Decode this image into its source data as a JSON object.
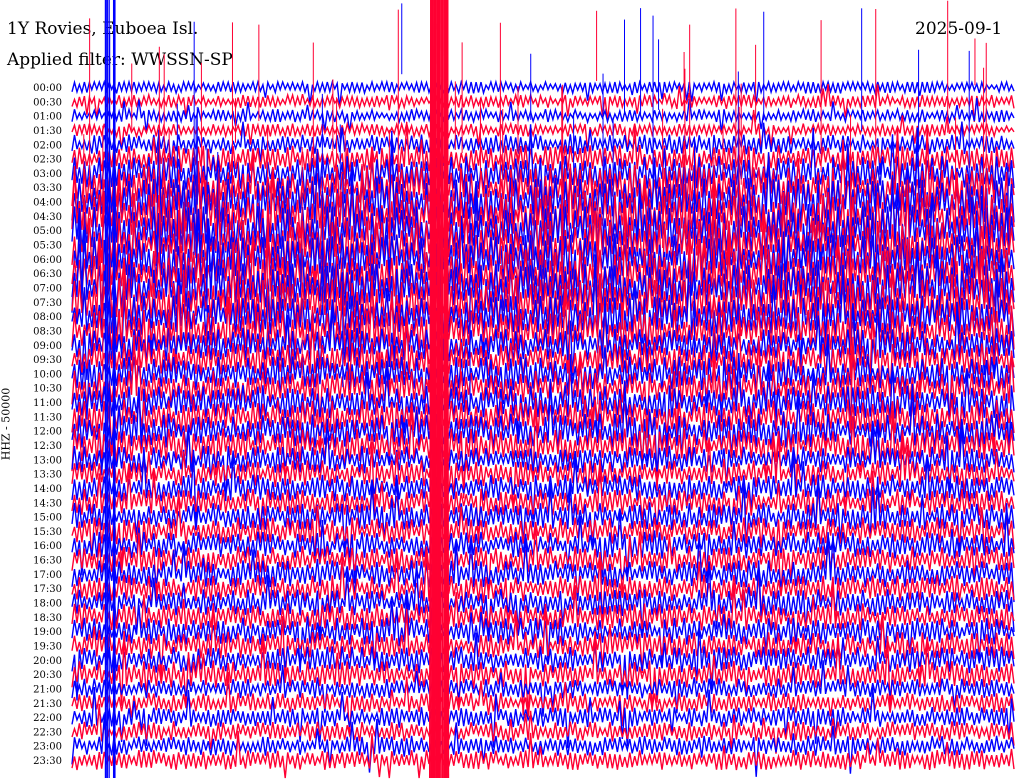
{
  "header": {
    "station": "1Y Rovies, Euboea Isl.",
    "filter": "Applied filter: WWSSN-SP",
    "date": "2025-09-1"
  },
  "chart_data": {
    "type": "line",
    "ylabel": "HHZ - 50000",
    "row_labels": [
      "00:00",
      "00:30",
      "01:00",
      "01:30",
      "02:00",
      "02:30",
      "03:00",
      "03:30",
      "04:00",
      "04:30",
      "05:00",
      "05:30",
      "06:00",
      "06:30",
      "07:00",
      "07:30",
      "08:00",
      "08:30",
      "09:00",
      "09:30",
      "10:00",
      "10:30",
      "11:00",
      "11:30",
      "12:00",
      "12:30",
      "13:00",
      "13:30",
      "14:00",
      "14:30",
      "15:00",
      "15:30",
      "16:00",
      "16:30",
      "17:00",
      "17:30",
      "18:00",
      "18:30",
      "19:00",
      "19:30",
      "20:00",
      "20:30",
      "21:00",
      "21:30",
      "22:00",
      "22:30",
      "23:00",
      "23:30"
    ],
    "series_colors": [
      "#0000ff",
      "#ff0033"
    ],
    "noise_level": [
      1,
      1,
      1,
      1,
      2,
      3,
      4,
      5,
      6,
      6,
      6,
      6,
      6,
      6,
      6,
      6,
      5,
      5,
      4,
      4,
      4,
      4,
      4,
      4,
      4,
      4,
      3,
      3,
      3,
      3,
      3,
      3,
      3,
      3,
      3,
      3,
      3,
      3,
      3,
      3,
      3,
      3,
      2,
      2,
      2,
      2,
      2,
      2
    ],
    "event_hours": [
      4.3,
      14.6,
      23.7
    ],
    "background": "#ffffff",
    "grid": false
  }
}
